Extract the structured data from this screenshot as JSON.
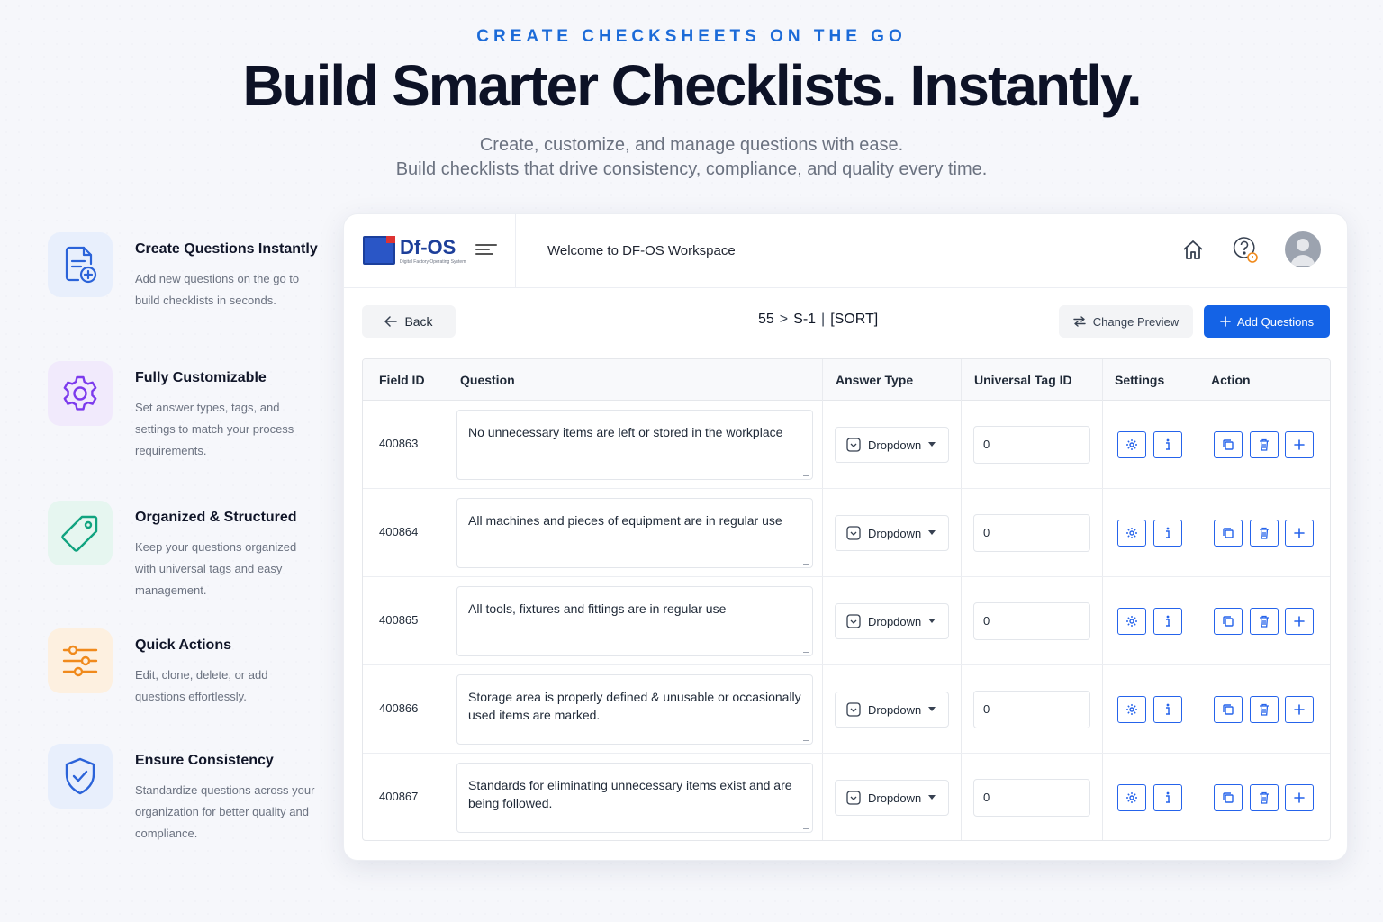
{
  "hero": {
    "eyebrow": "CREATE CHECKSHEETS ON THE GO",
    "headline": "Build Smarter Checklists. Instantly.",
    "subline1": "Create, customize, and manage questions with ease.",
    "subline2": "Build checklists that drive consistency, compliance, and quality every time."
  },
  "features": [
    {
      "title": "Create Questions Instantly",
      "desc": "Add new questions on the go to build checklists in seconds.",
      "icon": "document-plus-icon",
      "color": "#2b63d9"
    },
    {
      "title": "Fully Customizable",
      "desc": "Set answer types, tags, and settings to match your process requirements.",
      "icon": "gear-icon",
      "color": "#7c3aed"
    },
    {
      "title": "Organized & Structured",
      "desc": "Keep your questions organized with universal tags and easy management.",
      "icon": "tag-icon",
      "color": "#10a37f"
    },
    {
      "title": "Quick Actions",
      "desc": "Edit, clone, delete, or add questions effortlessly.",
      "icon": "sliders-icon",
      "color": "#f08a1c"
    },
    {
      "title": "Ensure Consistency",
      "desc": "Standardize questions across your organization for better quality and compliance.",
      "icon": "shield-check-icon",
      "color": "#2b63d9"
    }
  ],
  "app": {
    "brand_name": "Df-OS",
    "brand_sub": "Digital Factory Operating System",
    "welcome": "Welcome to DF-OS Workspace",
    "back_label": "Back",
    "breadcrumb": {
      "part1": "55",
      "part2": "S-1",
      "part3": "[SORT]"
    },
    "change_preview_label": "Change Preview",
    "add_questions_label": "Add Questions",
    "columns": [
      "Field ID",
      "Question",
      "Answer Type",
      "Universal Tag ID",
      "Settings",
      "Action"
    ],
    "rows": [
      {
        "field_id": "400863",
        "question": "No unnecessary items are left or stored in the workplace",
        "answer_type": "Dropdown",
        "tag_id": "0"
      },
      {
        "field_id": "400864",
        "question": "All machines and pieces of equipment are in regular use",
        "answer_type": "Dropdown",
        "tag_id": "0"
      },
      {
        "field_id": "400865",
        "question": "All tools, fixtures and fittings are in regular use",
        "answer_type": "Dropdown",
        "tag_id": "0"
      },
      {
        "field_id": "400866",
        "question": "Storage area is properly defined & unusable or occasionally used items are marked.",
        "answer_type": "Dropdown",
        "tag_id": "0"
      },
      {
        "field_id": "400867",
        "question": "Standards for eliminating unnecessary items exist and are being followed.",
        "answer_type": "Dropdown",
        "tag_id": "0"
      }
    ],
    "accent_color": "#1463e6"
  }
}
